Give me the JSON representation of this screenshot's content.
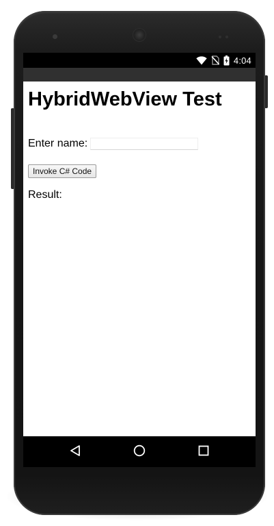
{
  "status_bar": {
    "time": "4:04",
    "icons": [
      "wifi-icon",
      "no-sim-icon",
      "battery-charging-icon"
    ]
  },
  "page": {
    "title": "HybridWebView Test",
    "name_label": "Enter name:",
    "name_input_value": "",
    "name_input_placeholder": "",
    "invoke_button_label": "Invoke C# Code",
    "result_label": "Result:",
    "result_value": ""
  },
  "nav_bar": {
    "buttons": [
      "back-icon",
      "home-icon",
      "recents-icon"
    ]
  },
  "colors": {
    "device_body": "#161616",
    "status_bar": "#000000",
    "toolbar": "#303030",
    "webview_background": "#ffffff",
    "nav_bar": "#000000"
  }
}
